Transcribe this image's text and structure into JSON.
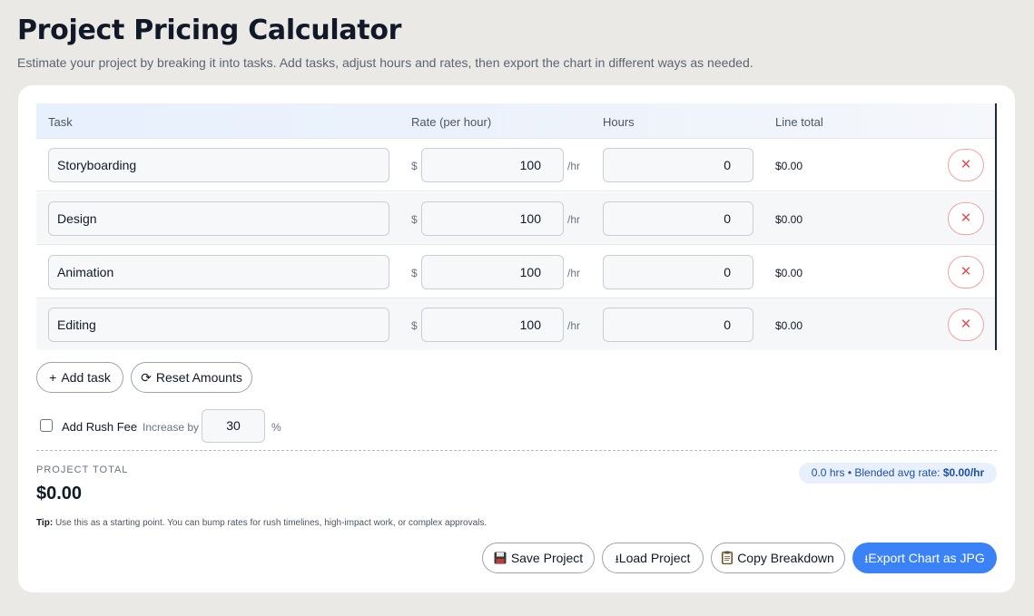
{
  "header": {
    "title": "Project Pricing Calculator",
    "subtitle": "Estimate your project by breaking it into tasks. Add tasks, adjust hours and rates, then export the chart in different ways as needed."
  },
  "table": {
    "columns": {
      "task": "Task",
      "rate": "Rate (per hour)",
      "hours": "Hours",
      "line_total": "Line total"
    },
    "currency_symbol": "$",
    "rate_unit": "/hr",
    "rows": [
      {
        "task": "Storyboarding",
        "rate": "100",
        "hours": "0",
        "line_total": "$0.00"
      },
      {
        "task": "Design",
        "rate": "100",
        "hours": "0",
        "line_total": "$0.00"
      },
      {
        "task": "Animation",
        "rate": "100",
        "hours": "0",
        "line_total": "$0.00"
      },
      {
        "task": "Editing",
        "rate": "100",
        "hours": "0",
        "line_total": "$0.00"
      }
    ]
  },
  "actions": {
    "add_task": "Add task",
    "add_task_icon": "+",
    "reset": "Reset Amounts",
    "reset_icon": "⟳"
  },
  "rush": {
    "checked": false,
    "label": "Add Rush Fee",
    "increase_label": "Increase by",
    "value": "30",
    "unit": "%"
  },
  "summary": {
    "total_label": "PROJECT TOTAL",
    "total_value": "$0.00",
    "hours_value": "0.0",
    "hours_unit": "hrs",
    "separator": "•",
    "blended_label": "Blended avg rate:",
    "blended_value": "$0.00/hr"
  },
  "tip": {
    "label": "Tip:",
    "text": "Use this as a starting point. You can bump rates for rush timelines, high-impact work, or complex approvals."
  },
  "footer": {
    "save": "Save Project",
    "load": "Load Project",
    "copy": "Copy Breakdown",
    "export": "Export Chart as JPG"
  },
  "colors": {
    "accent": "#3b82f6",
    "danger": "#e05252",
    "background": "#ebe9e5"
  }
}
